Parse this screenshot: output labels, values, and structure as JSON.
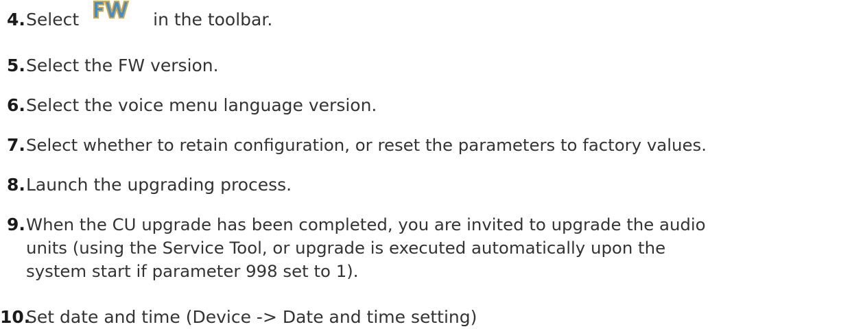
{
  "steps": [
    {
      "num": "4.",
      "before": "Select",
      "icon": "fw-firmware-icon",
      "after": "in the toolbar."
    },
    {
      "num": "5.",
      "text": "Select the FW version."
    },
    {
      "num": "6.",
      "text": "Select the voice menu language version."
    },
    {
      "num": "7.",
      "text": "Select whether to retain configuration, or reset the parameters to factory values."
    },
    {
      "num": "8.",
      "text": "Launch the upgrading process."
    },
    {
      "num": "9.",
      "lines": [
        "When the CU upgrade has been completed, you are invited to upgrade the audio",
        "units (using the Service Tool, or upgrade is executed automatically upon the",
        "system start if parameter 998 set to 1)."
      ]
    },
    {
      "num": "10.",
      "text": "Set date and time (Device -> Date and time setting)"
    }
  ],
  "icon_colors": {
    "fw_fill": "#3b8fd6",
    "fw_outline": "#d9a53a"
  }
}
